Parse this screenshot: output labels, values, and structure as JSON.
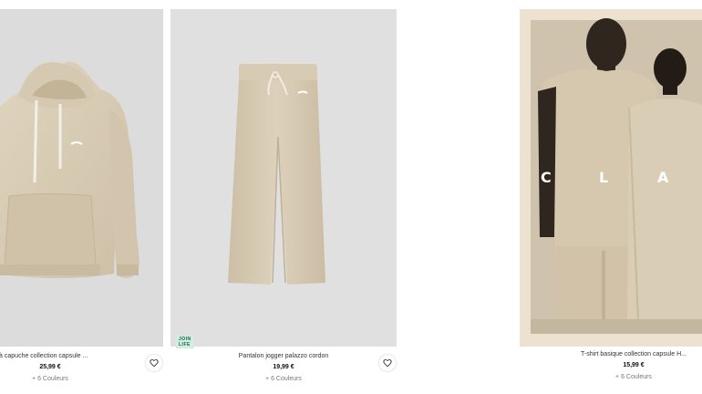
{
  "products": [
    {
      "name": "Sweat à capuche collection capsule ...",
      "price": "25,99 €",
      "colors": "+ 6 Couleurs",
      "wishlist_icon": "heart-outline-icon"
    },
    {
      "name": "Pantalon jogger palazzo cordon",
      "price": "19,99 €",
      "colors": "+ 6 Couleurs",
      "badge": "JOIN LIFE",
      "wishlist_icon": "heart-outline-icon"
    },
    {
      "name": "T-shirt basique collection capsule H...",
      "price": "15,99 €",
      "colors": "+ 6 Couleurs"
    }
  ],
  "campaign": {
    "letters": [
      "C",
      "L",
      "A"
    ]
  },
  "colors": {
    "photo_bg": "#dedede",
    "product_beige": "#d9ccb6",
    "campaign_frame": "#ece2cf",
    "badge_bg": "#cfeee0"
  }
}
